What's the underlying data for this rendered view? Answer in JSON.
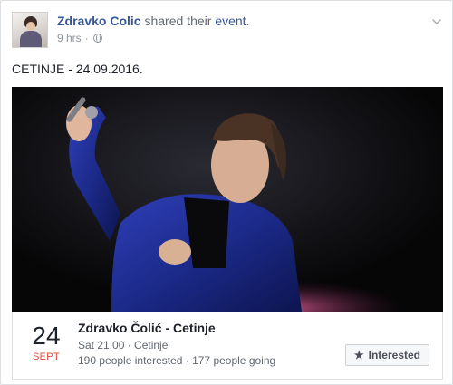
{
  "post": {
    "author": "Zdravko Colic",
    "action_text": "shared their",
    "event_link": "event",
    "time_ago": "9 hrs",
    "separator": "·",
    "audience_icon": "globe-icon",
    "menu_icon": "chevron-down-icon",
    "text": "CETINJE - 24.09.2016."
  },
  "event": {
    "day": "24",
    "month": "SEPT",
    "title": "Zdravko Čolić - Cetinje",
    "time_location": "Sat 21:00 · Cetinje",
    "stats": "190 people interested · 177 people going",
    "interested_label": "Interested",
    "interested_icon": "star-icon"
  },
  "colors": {
    "link": "#365899",
    "month_red": "#e04a3a",
    "jacket_blue": "#1c2a8a"
  }
}
